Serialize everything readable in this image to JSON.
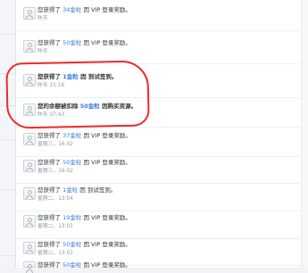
{
  "feed": [
    {
      "prefix": "您获得了",
      "amount": "34金粒",
      "suffix": "因 VIP 登录奖励。",
      "time": "昨天"
    },
    {
      "prefix": "您获得了",
      "amount": "50金粒",
      "suffix": "因 VIP 登录奖励。",
      "time": "昨天"
    },
    {
      "prefix": "您获得了",
      "amount": "1金粒",
      "suffix": "因 到试签到。",
      "time": "昨天 15:16"
    },
    {
      "prefix": "您的余额被扣除",
      "amount": "50金粒",
      "suffix": "因购买资源。",
      "time": "昨天 07:43"
    },
    {
      "prefix": "您获得了",
      "amount": "37金粒",
      "suffix": "因 VIP 登录奖励。",
      "time": "星期三。16:02"
    },
    {
      "prefix": "您获得了",
      "amount": "50金粒",
      "suffix": "因 VIP 登录奖励。",
      "time": "星期三。16:02"
    },
    {
      "prefix": "您获得了",
      "amount": "1金粒",
      "suffix": "因 到试签到。",
      "time": "星期二。13:04"
    },
    {
      "prefix": "您获得了",
      "amount": "19金粒",
      "suffix": "因 VIP 登录奖励。",
      "time": "星期二。13:01"
    },
    {
      "prefix": "您获得了",
      "amount": "50金粒",
      "suffix": "因 VIP 登录奖励。",
      "time": "星期二。13:01"
    },
    {
      "prefix": "您获得了",
      "amount": "50金粒",
      "suffix": "因 VIP 登录奖励。",
      "time": ""
    }
  ],
  "colors": {
    "page_background": "#f1f3f6",
    "panel_background": "#ffffff",
    "text": "#333333",
    "amount_link": "#3b7dd8",
    "timestamp": "#8b97a6",
    "annotation": "#ee2a2a"
  }
}
